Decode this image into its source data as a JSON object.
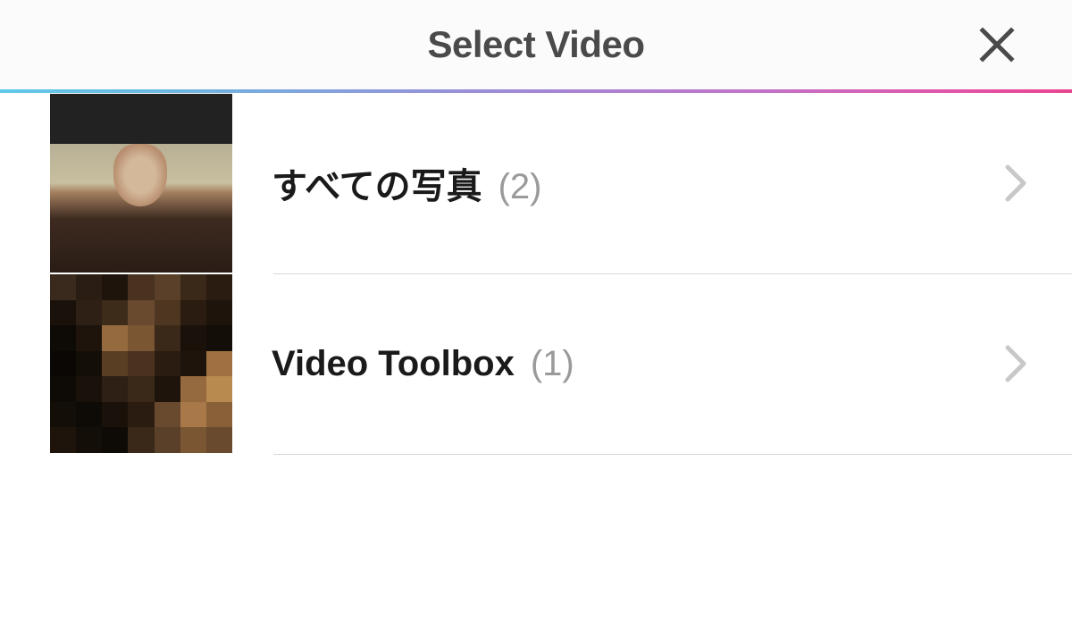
{
  "header": {
    "title": "Select Video"
  },
  "albums": [
    {
      "label": "すべての写真",
      "count": "(2)"
    },
    {
      "label": "Video Toolbox",
      "count": "(1)"
    }
  ]
}
